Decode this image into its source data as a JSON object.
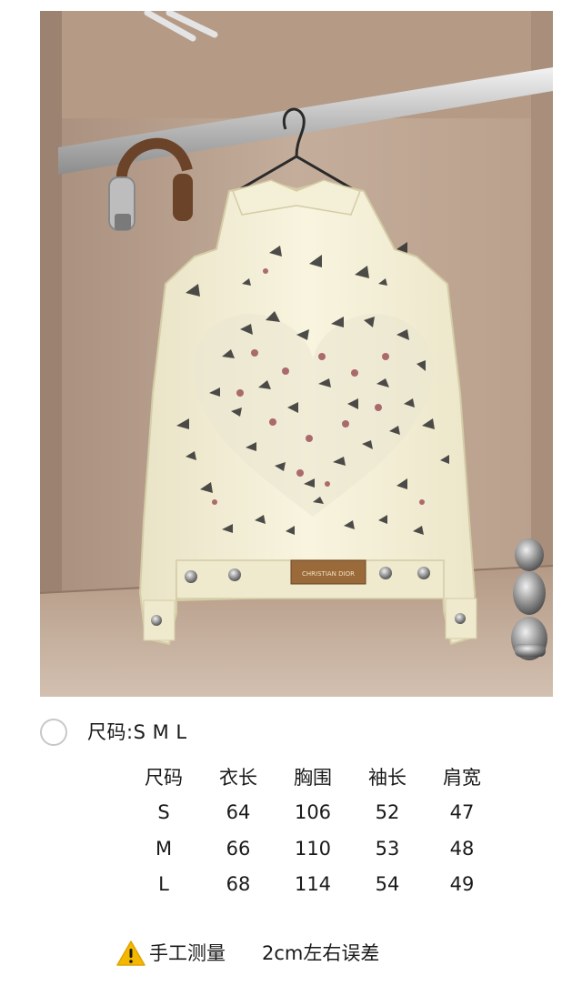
{
  "product": {
    "photo_label": "Photo of cream denim jacket with butterfly heart print hanging in wardrobe",
    "patch_text": "CHRISTIAN DIOR"
  },
  "options": {
    "size_line": "尺码:S  M  L"
  },
  "size_table": {
    "headers": [
      "尺码",
      "衣长",
      "胸围",
      "袖长",
      "肩宽"
    ],
    "rows": [
      [
        "S",
        "64",
        "106",
        "52",
        "47"
      ],
      [
        "M",
        "66",
        "110",
        "53",
        "48"
      ],
      [
        "L",
        "68",
        "114",
        "54",
        "49"
      ]
    ]
  },
  "note": {
    "icon": "warning-icon",
    "text_left": "手工测量",
    "text_right": "2cm左右误差"
  },
  "colors": {
    "warning": "#f5b800",
    "jacket": "#f6f1d8",
    "wood": "#b89e89"
  }
}
